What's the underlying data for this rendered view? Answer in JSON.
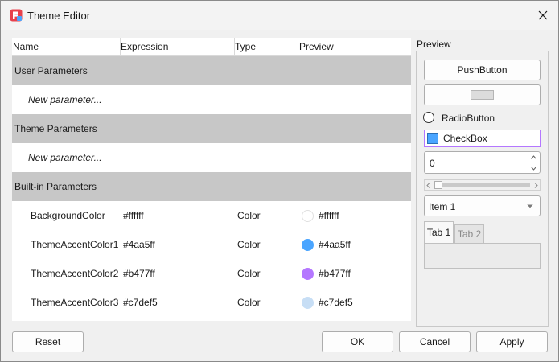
{
  "window": {
    "title": "Theme Editor",
    "close_icon": "close-icon",
    "app_icon": "qt-designer-icon"
  },
  "tree": {
    "columns": [
      "Name",
      "Expression",
      "Type",
      "Preview"
    ],
    "sections": [
      {
        "label": "User Parameters",
        "new_param": "New parameter..."
      },
      {
        "label": "Theme Parameters",
        "new_param": "New parameter..."
      },
      {
        "label": "Built-in Parameters"
      }
    ],
    "builtins": [
      {
        "name": "BackgroundColor",
        "expression": "#ffffff",
        "type": "Color",
        "preview_color": "#ffffff",
        "preview_text": "#ffffff"
      },
      {
        "name": "ThemeAccentColor1",
        "expression": "#4aa5ff",
        "type": "Color",
        "preview_color": "#4aa5ff",
        "preview_text": "#4aa5ff"
      },
      {
        "name": "ThemeAccentColor2",
        "expression": "#b477ff",
        "type": "Color",
        "preview_color": "#b477ff",
        "preview_text": "#b477ff"
      },
      {
        "name": "ThemeAccentColor3",
        "expression": "#c7def5",
        "type": "Color",
        "preview_color": "#c7def5",
        "preview_text": "#c7def5"
      }
    ]
  },
  "preview": {
    "label": "Preview",
    "push_button": "PushButton",
    "radio_button": "RadioButton",
    "checkbox": "CheckBox",
    "checkbox_color": "#4aa5ff",
    "checkbox_border": "#b477ff",
    "spin_value": "0",
    "combo_value": "Item 1",
    "tabs": [
      "Tab 1",
      "Tab 2"
    ]
  },
  "footer": {
    "reset": "Reset",
    "ok": "OK",
    "cancel": "Cancel",
    "apply": "Apply"
  }
}
